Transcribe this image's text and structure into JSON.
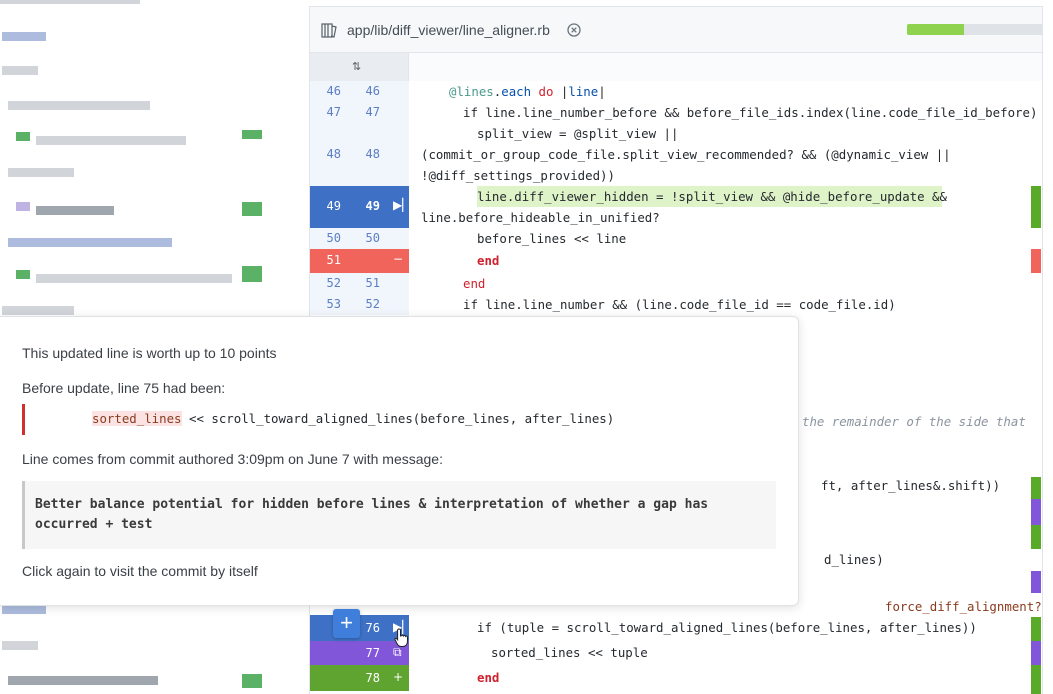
{
  "file": {
    "path": "app/lib/diff_viewer/line_aligner.rb",
    "progress_fraction": 0.42
  },
  "gutter_icon": "sort-icon",
  "rows": [
    {
      "before": "46",
      "after": "46"
    },
    {
      "before": "47",
      "after": "47"
    },
    {
      "before": "48",
      "after": "48"
    },
    {
      "before": "49",
      "after": "49"
    },
    {
      "before": "50",
      "after": "50"
    },
    {
      "before": "51",
      "after": ""
    },
    {
      "before": "52",
      "after": "51"
    },
    {
      "before": "53",
      "after": "52"
    },
    {
      "before": "7",
      "after": "76"
    },
    {
      "before": "",
      "after": "77"
    },
    {
      "before": "",
      "after": "78"
    }
  ],
  "code": {
    "l46": "@lines.each do |line|",
    "l47a": "if line.line_number_before && before_file_ids.index(line.code_file_id_before)",
    "l48a": "split_view = @split_view ||",
    "l48b": "(commit_or_group_code_file.split_view_recommended? && (@dynamic_view ||",
    "l48c": "!@diff_settings_provided))",
    "l49a": "line.diff_viewer_hidden = !split_view && @hide_before_update &&",
    "l49b": "line.before_hideable_in_unified?",
    "l50": "before_lines << line",
    "l51": "end",
    "l52": "end",
    "l53": "if line.line_number && (line.code_file_id == code_file.id)",
    "frag1": "the remainder of the side that",
    "frag2": "ft, after_lines&.shift))",
    "frag3": "d_lines)",
    "frag4": "force_diff_alignment?",
    "l76": "if (tuple = scroll_toward_aligned_lines(before_lines, after_lines))",
    "l77": "sorted_lines << tuple",
    "l78": "end"
  },
  "popover": {
    "worth": "This updated line is worth up to 10 points",
    "before_label": "Before update, line 75 had been:",
    "before_code": "sorted_lines << scroll_toward_aligned_lines(before_lines, after_lines)",
    "commit_label": "Line comes from commit authored 3:09pm on June 7 with message:",
    "commit_message": "Better balance potential for hidden before lines & interpretation of whether a gap has occurred + test",
    "footer": "Click again to visit the commit by itself"
  },
  "buttons": {
    "plus": "+"
  },
  "colors": {
    "selected_row": "#3e71c6",
    "deleted_row": "#f0645c",
    "added_row": "#5fa431",
    "moved_row": "#8156d9",
    "added_bar": "#5aaa2a",
    "moved_bar": "#8156d9",
    "deleted_bar": "#f0645c"
  }
}
